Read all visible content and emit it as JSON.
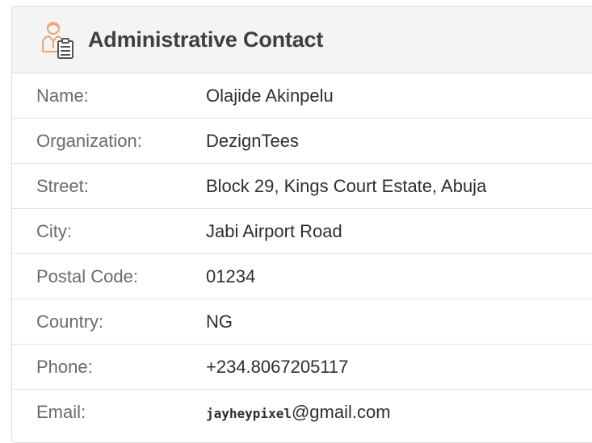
{
  "panel": {
    "title": "Administrative Contact",
    "icon": "contact-clipboard-icon",
    "icon_color": "#f0a36b"
  },
  "contact": {
    "rows": [
      {
        "label": "Name:",
        "value": "Olajide Akinpelu"
      },
      {
        "label": "Organization:",
        "value": "DezignTees"
      },
      {
        "label": "Street:",
        "value": "Block 29, Kings Court Estate, Abuja"
      },
      {
        "label": "City:",
        "value": "Jabi Airport Road"
      },
      {
        "label": "Postal Code:",
        "value": "01234"
      },
      {
        "label": "Country:",
        "value": "NG"
      },
      {
        "label": "Phone:",
        "value": "+234.8067205117"
      }
    ],
    "email": {
      "label": "Email:",
      "user": "jayheypixel",
      "domain": "@gmail.com"
    }
  }
}
